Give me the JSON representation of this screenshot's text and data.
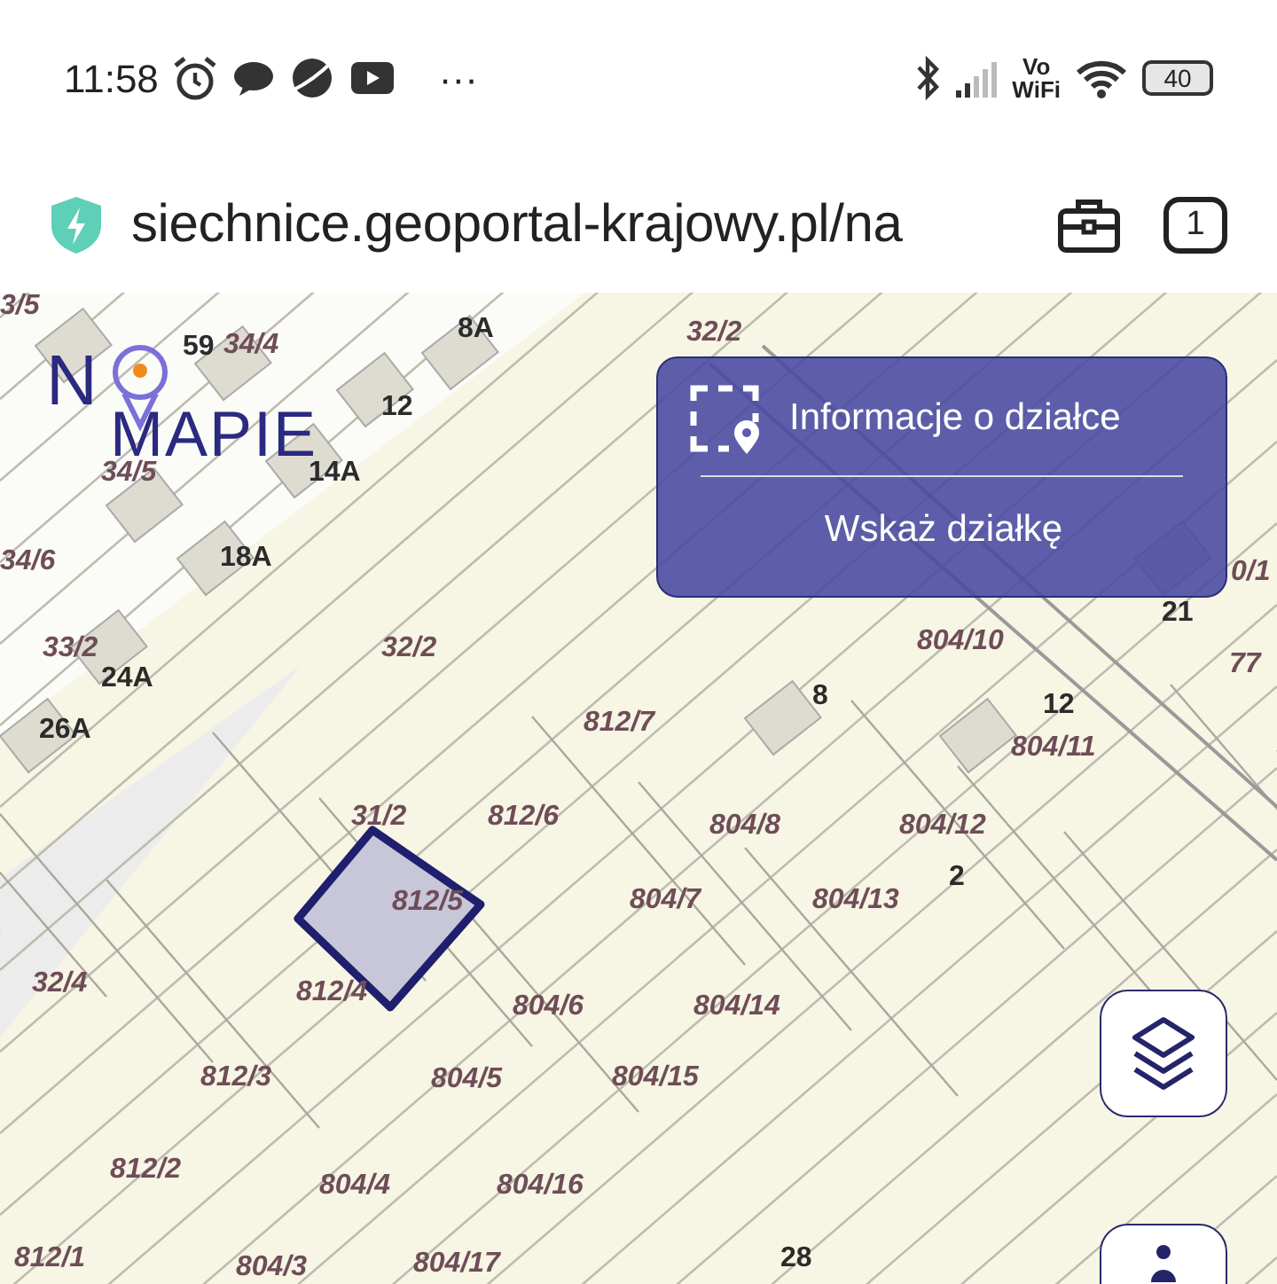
{
  "status_bar": {
    "time": "11:58",
    "more": "···",
    "wifi_calling": [
      "Vo",
      "WiFi"
    ],
    "battery": "40"
  },
  "browser": {
    "url": "siechnice.geoportal-krajowy.pl/na",
    "tab_count": "1"
  },
  "map": {
    "logo": [
      "N",
      "MAPIE"
    ],
    "labels": [
      {
        "text": "3/5",
        "kind": "parcel"
      },
      {
        "text": "59",
        "kind": "building"
      },
      {
        "text": "34/4",
        "kind": "parcel"
      },
      {
        "text": "8A",
        "kind": "building"
      },
      {
        "text": "32/2",
        "kind": "parcel"
      },
      {
        "text": "12",
        "kind": "building"
      },
      {
        "text": "34/5",
        "kind": "parcel"
      },
      {
        "text": "14A",
        "kind": "building"
      },
      {
        "text": "34/6",
        "kind": "parcel"
      },
      {
        "text": "18A",
        "kind": "building"
      },
      {
        "text": "0/1",
        "kind": "parcel"
      },
      {
        "text": "21",
        "kind": "building"
      },
      {
        "text": "33/2",
        "kind": "parcel"
      },
      {
        "text": "24A",
        "kind": "building"
      },
      {
        "text": "32/2",
        "kind": "parcel"
      },
      {
        "text": "804/10",
        "kind": "parcel"
      },
      {
        "text": "77",
        "kind": "parcel"
      },
      {
        "text": "8",
        "kind": "building"
      },
      {
        "text": "12",
        "kind": "building"
      },
      {
        "text": "26A",
        "kind": "building"
      },
      {
        "text": "812/7",
        "kind": "parcel"
      },
      {
        "text": "804/11",
        "kind": "parcel"
      },
      {
        "text": "31/2",
        "kind": "parcel"
      },
      {
        "text": "812/6",
        "kind": "parcel"
      },
      {
        "text": "804/8",
        "kind": "parcel"
      },
      {
        "text": "804/12",
        "kind": "parcel"
      },
      {
        "text": "2",
        "kind": "building"
      },
      {
        "text": "812/5",
        "kind": "parcel"
      },
      {
        "text": "804/7",
        "kind": "parcel"
      },
      {
        "text": "804/13",
        "kind": "parcel"
      },
      {
        "text": "32/4",
        "kind": "parcel"
      },
      {
        "text": "812/4",
        "kind": "parcel"
      },
      {
        "text": "804/6",
        "kind": "parcel"
      },
      {
        "text": "804/14",
        "kind": "parcel"
      },
      {
        "text": "812/3",
        "kind": "parcel"
      },
      {
        "text": "804/5",
        "kind": "parcel"
      },
      {
        "text": "804/15",
        "kind": "parcel"
      },
      {
        "text": "812/2",
        "kind": "parcel"
      },
      {
        "text": "804/4",
        "kind": "parcel"
      },
      {
        "text": "804/16",
        "kind": "parcel"
      },
      {
        "text": "812/1",
        "kind": "parcel"
      },
      {
        "text": "804/3",
        "kind": "parcel"
      },
      {
        "text": "804/17",
        "kind": "parcel"
      },
      {
        "text": "28",
        "kind": "building"
      }
    ],
    "popup": {
      "title": "Informacje o działce",
      "action": "Wskaż działkę"
    }
  }
}
